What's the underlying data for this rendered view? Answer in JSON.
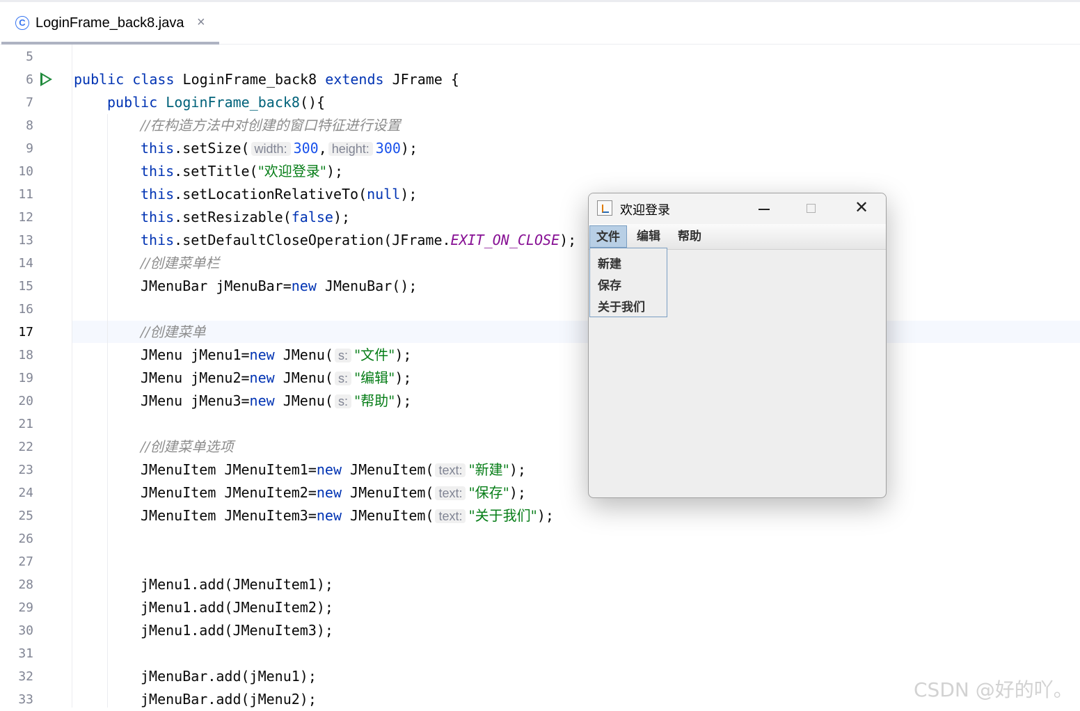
{
  "editor_tab": {
    "icon": "class-icon",
    "icon_glyph": "C",
    "title": "LoginFrame_back8.java",
    "close": "×"
  },
  "gutter": {
    "current_line": 17,
    "line_numbers": [
      "5",
      "6",
      "7",
      "8",
      "9",
      "10",
      "11",
      "12",
      "13",
      "14",
      "15",
      "16",
      "17",
      "18",
      "19",
      "20",
      "21",
      "22",
      "23",
      "24",
      "25",
      "26",
      "27",
      "28",
      "29",
      "30",
      "31",
      "32",
      "33"
    ]
  },
  "code": {
    "l6": {
      "kw1": "public class",
      "name": " LoginFrame_back8 ",
      "kw2": "extends",
      "rest": " JFrame {"
    },
    "l7": {
      "kw": "public",
      "ctor": " LoginFrame_back8",
      "rest": "(){"
    },
    "l8": {
      "comment": "//在构造方法中对创建的窗口特征进行设置"
    },
    "l9": {
      "this": "this",
      "call": ".setSize(",
      "hint1": "width:",
      "v1": "300",
      "sep": ",",
      "hint2": "height:",
      "v2": "300",
      "end": ");"
    },
    "l10": {
      "this": "this",
      "call": ".setTitle(",
      "str": "\"欢迎登录\"",
      "end": ");"
    },
    "l11": {
      "this": "this",
      "call": ".setLocationRelativeTo(",
      "kw": "null",
      "end": ");"
    },
    "l12": {
      "this": "this",
      "call": ".setResizable(",
      "kw": "false",
      "end": ");"
    },
    "l13": {
      "this": "this",
      "call": ".setDefaultCloseOperation(JFrame.",
      "const": "EXIT_ON_CLOSE",
      "end": ");"
    },
    "l14": {
      "comment": "//创建菜单栏"
    },
    "l15": {
      "pre": "JMenuBar jMenuBar=",
      "kw": "new",
      "post": " JMenuBar();"
    },
    "l17": {
      "comment": "//创建菜单"
    },
    "l18": {
      "pre": "JMenu jMenu1=",
      "kw": "new",
      "mid": " JMenu(",
      "hint": "s:",
      "str": "\"文件\"",
      "end": ");"
    },
    "l19": {
      "pre": "JMenu jMenu2=",
      "kw": "new",
      "mid": " JMenu(",
      "hint": "s:",
      "str": "\"编辑\"",
      "end": ");"
    },
    "l20": {
      "pre": "JMenu jMenu3=",
      "kw": "new",
      "mid": " JMenu(",
      "hint": "s:",
      "str": "\"帮助\"",
      "end": ");"
    },
    "l22": {
      "comment": "//创建菜单选项"
    },
    "l23": {
      "pre": "JMenuItem JMenuItem1=",
      "kw": "new",
      "mid": " JMenuItem(",
      "hint": "text:",
      "str": "\"新建\"",
      "end": ");"
    },
    "l24": {
      "pre": "JMenuItem JMenuItem2=",
      "kw": "new",
      "mid": " JMenuItem(",
      "hint": "text:",
      "str": "\"保存\"",
      "end": ");"
    },
    "l25": {
      "pre": "JMenuItem JMenuItem3=",
      "kw": "new",
      "mid": " JMenuItem(",
      "hint": "text:",
      "str": "\"关于我们\"",
      "end": ");"
    },
    "l28": "jMenu1.add(JMenuItem1);",
    "l29": "jMenu1.add(JMenuItem2);",
    "l30": "jMenu1.add(JMenuItem3);",
    "l32": "jMenuBar.add(jMenu1);",
    "l33": "jMenuBar.add(jMenu2);"
  },
  "swing_window": {
    "title": "欢迎登录",
    "menus": [
      "文件",
      "编辑",
      "帮助"
    ],
    "active_menu": "文件",
    "menu_items": [
      "新建",
      "保存",
      "关于我们"
    ],
    "close_glyph": "✕"
  },
  "watermark": "CSDN @好的吖。"
}
